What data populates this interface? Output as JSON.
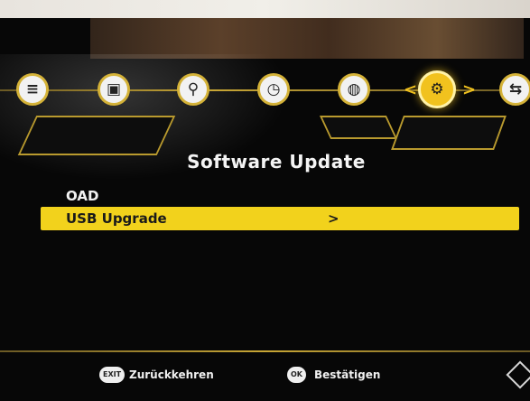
{
  "menu": {
    "icons": [
      "info-icon",
      "picture-icon",
      "search-icon",
      "clock-icon",
      "globe-icon",
      "gear-icon",
      "usb-icon"
    ],
    "active_index": 5,
    "nav_left": "<",
    "nav_right": ">"
  },
  "page_title": "Software Update",
  "items": [
    {
      "label": "OAD"
    },
    {
      "label": "USB Upgrade",
      "arrow": ">"
    }
  ],
  "footer": {
    "back_key": "EXIT",
    "back_label": "Zurückkehren",
    "confirm_key": "OK",
    "confirm_label": "Bestätigen"
  },
  "colors": {
    "accent": "#f1c21e",
    "selection": "#f2d21c",
    "background": "#070707"
  }
}
